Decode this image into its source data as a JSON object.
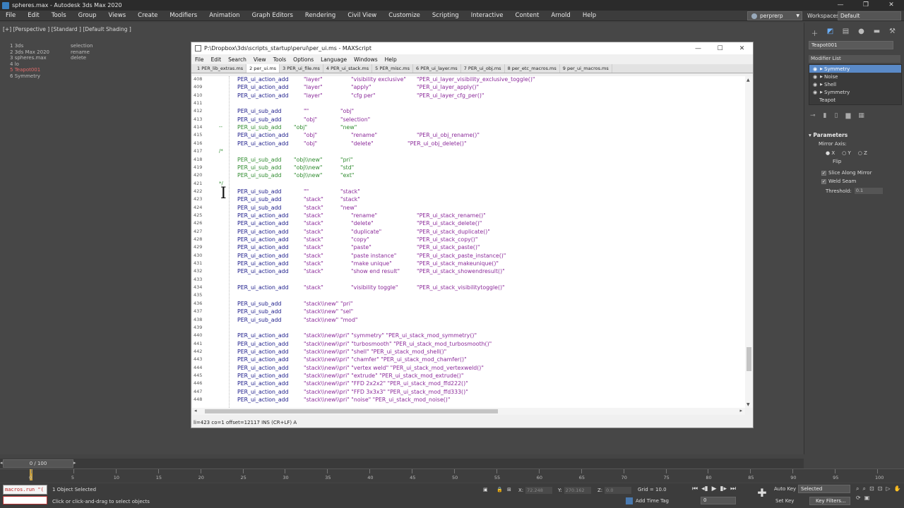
{
  "app": {
    "title": "spheres.max - Autodesk 3ds Max 2020",
    "window_controls": [
      "—",
      "❐",
      "✕"
    ]
  },
  "menu": [
    "File",
    "Edit",
    "Tools",
    "Group",
    "Views",
    "Create",
    "Modifiers",
    "Animation",
    "Graph Editors",
    "Rendering",
    "Civil View",
    "Customize",
    "Scripting",
    "Interactive",
    "Content",
    "Arnold",
    "Help"
  ],
  "user": "perprerp",
  "workspaces": {
    "label": "Workspaces:",
    "value": "Default"
  },
  "viewport": {
    "label": "[+] [Perspective ] [Standard ] [Default Shading ]",
    "scene_list": [
      "3ds",
      "3ds Max 2020",
      "spheres.max",
      "lo",
      "Teapot001",
      "Symmetry"
    ],
    "scene_list_numbers": [
      "1",
      "2",
      "3",
      "4",
      "5",
      "6"
    ],
    "selected_index": 4,
    "menu_list": [
      "selection",
      "rename",
      "delete"
    ]
  },
  "editor": {
    "title": "P:\\Dropbox\\3ds\\scripts_startup\\perui\\per_ui.ms - MAXScript",
    "menu": [
      "File",
      "Edit",
      "Search",
      "View",
      "Tools",
      "Options",
      "Language",
      "Windows",
      "Help"
    ],
    "tabs": [
      "1 PER_lib_extras.ms",
      "2 per_ui.ms",
      "3 PER_ui_file.ms",
      "4 PER_ui_stack.ms",
      "5 PER_misc.ms",
      "6 PER_ui_layer.ms",
      "7 PER_ui_obj.ms",
      "8 per_etc_macros.ms",
      "9 per_ui_macros.ms"
    ],
    "active_tab": 1,
    "status": "li=423 co=1 offset=12117 INS (CR+LF) A",
    "lines": [
      {
        "n": "408",
        "k": "PER_ui_action_add",
        "a": "\"layer\"",
        "b": "\"visibility exclusive\"",
        "c": "\"PER_ui_layer_visibility_exclusive_toggle()\""
      },
      {
        "n": "409",
        "k": "PER_ui_action_add",
        "a": "\"layer\"",
        "b": "\"apply\"",
        "c": "\"PER_ui_layer_apply()\""
      },
      {
        "n": "410",
        "k": "PER_ui_action_add",
        "a": "\"layer\"",
        "b": "\"cfg per\"",
        "c": "\"PER_ui_layer_cfg_per()\""
      },
      {
        "n": "411"
      },
      {
        "n": "412",
        "k": "PER_ui_sub_add",
        "a": "\"\"",
        "b": "\"obj\""
      },
      {
        "n": "413",
        "k": "PER_ui_sub_add",
        "a": "\"obj\"",
        "b": "\"selection\""
      },
      {
        "n": "414",
        "k": "PER_ui_sub_add",
        "a": "\"obj\"",
        "b": "\"new\"",
        "comment": true,
        "mark": "--"
      },
      {
        "n": "415",
        "k": "PER_ui_action_add",
        "a": "\"obj\"",
        "b": "\"rename\"",
        "c": "\"PER_ui_obj_rename()\""
      },
      {
        "n": "416",
        "k": "PER_ui_action_add",
        "a": "\"obj\"",
        "b": "\"delete\"",
        "c": "\"PER_ui_obj_delete()\""
      },
      {
        "n": "417",
        "mark": "/*",
        "comment": true
      },
      {
        "n": "418",
        "k": "PER_ui_sub_add",
        "a": "\"obj\\\\new\"",
        "b": "\"pri\"",
        "comment": true
      },
      {
        "n": "419",
        "k": "PER_ui_sub_add",
        "a": "\"obj\\\\new\"",
        "b": "\"std\"",
        "comment": true
      },
      {
        "n": "420",
        "k": "PER_ui_sub_add",
        "a": "\"obj\\\\new\"",
        "b": "\"ext\"",
        "comment": true
      },
      {
        "n": "421",
        "mark": "*/",
        "comment": true
      },
      {
        "n": "422",
        "k": "PER_ui_sub_add",
        "a": "\"\"",
        "b": "\"stack\""
      },
      {
        "n": "423",
        "k": "PER_ui_sub_add",
        "a": "\"stack\"",
        "b": "\"stack\""
      },
      {
        "n": "424",
        "k": "PER_ui_sub_add",
        "a": "\"stack\"",
        "b": "\"new\""
      },
      {
        "n": "425",
        "k": "PER_ui_action_add",
        "a": "\"stack\"",
        "b": "\"rename\"",
        "c": "\"PER_ui_stack_rename()\""
      },
      {
        "n": "426",
        "k": "PER_ui_action_add",
        "a": "\"stack\"",
        "b": "\"delete\"",
        "c": "\"PER_ui_stack_delete()\""
      },
      {
        "n": "427",
        "k": "PER_ui_action_add",
        "a": "\"stack\"",
        "b": "\"duplicate\"",
        "c": "\"PER_ui_stack_duplicate()\""
      },
      {
        "n": "428",
        "k": "PER_ui_action_add",
        "a": "\"stack\"",
        "b": "\"copy\"",
        "c": "\"PER_ui_stack_copy()\""
      },
      {
        "n": "429",
        "k": "PER_ui_action_add",
        "a": "\"stack\"",
        "b": "\"paste\"",
        "c": "\"PER_ui_stack_paste()\""
      },
      {
        "n": "430",
        "k": "PER_ui_action_add",
        "a": "\"stack\"",
        "b": "\"paste instance\"",
        "c": "\"PER_ui_stack_paste_instance()\""
      },
      {
        "n": "431",
        "k": "PER_ui_action_add",
        "a": "\"stack\"",
        "b": "\"make unique\"",
        "c": "\"PER_ui_stack_makeunique()\""
      },
      {
        "n": "432",
        "k": "PER_ui_action_add",
        "a": "\"stack\"",
        "b": "\"show end result\"",
        "c": "\"PER_ui_stack_showendresult()\""
      },
      {
        "n": "433"
      },
      {
        "n": "434",
        "k": "PER_ui_action_add",
        "a": "\"stack\"",
        "b": "\"visibility toggle\"",
        "c": "\"PER_ui_stack_visibilitytoggle()\""
      },
      {
        "n": "435"
      },
      {
        "n": "436",
        "k": "PER_ui_sub_add",
        "a": "\"stack\\\\new\"",
        "b": "\"pri\""
      },
      {
        "n": "437",
        "k": "PER_ui_sub_add",
        "a": "\"stack\\\\new\"",
        "b": "\"sel\""
      },
      {
        "n": "438",
        "k": "PER_ui_sub_add",
        "a": "\"stack\\\\new\"",
        "b": "\"mod\""
      },
      {
        "n": "439"
      },
      {
        "n": "440",
        "k": "PER_ui_action_add",
        "a": "\"stack\\\\new\\\\pri\" \"symmetry\" \"PER_ui_stack_mod_symmetry()\""
      },
      {
        "n": "441",
        "k": "PER_ui_action_add",
        "a": "\"stack\\\\new\\\\pri\" \"turbosmooth\" \"PER_ui_stack_mod_turbosmooth()\""
      },
      {
        "n": "442",
        "k": "PER_ui_action_add",
        "a": "\"stack\\\\new\\\\pri\" \"shell\" \"PER_ui_stack_mod_shell()\""
      },
      {
        "n": "443",
        "k": "PER_ui_action_add",
        "a": "\"stack\\\\new\\\\pri\" \"chamfer\" \"PER_ui_stack_mod_chamfer()\""
      },
      {
        "n": "444",
        "k": "PER_ui_action_add",
        "a": "\"stack\\\\new\\\\pri\" \"vertex weld\" \"PER_ui_stack_mod_vertexweld()\""
      },
      {
        "n": "445",
        "k": "PER_ui_action_add",
        "a": "\"stack\\\\new\\\\pri\" \"extrude\" \"PER_ui_stack_mod_extrude()\""
      },
      {
        "n": "446",
        "k": "PER_ui_action_add",
        "a": "\"stack\\\\new\\\\pri\" \"FFD 2x2x2\" \"PER_ui_stack_mod_ffd222()\""
      },
      {
        "n": "447",
        "k": "PER_ui_action_add",
        "a": "\"stack\\\\new\\\\pri\" \"FFD 3x3x3\" \"PER_ui_stack_mod_ffd333()\""
      },
      {
        "n": "448",
        "k": "PER_ui_action_add",
        "a": "\"stack\\\\new\\\\pri\" \"noise\" \"PER_ui_stack_mod_noise()\""
      }
    ]
  },
  "command_panel": {
    "object_name": "Teapot001",
    "modifier_list_label": "Modifier List",
    "stack": [
      "Symmetry",
      "Noise",
      "Shell",
      "Symmetry",
      "Teapot"
    ],
    "selected_stack_index": 0,
    "rollout_title": "Parameters",
    "mirror_axis_label": "Mirror Axis:",
    "axes": [
      "X",
      "Y",
      "Z"
    ],
    "flip_label": "Flip",
    "slice_label": "Slice Along Mirror",
    "weld_label": "Weld Seam",
    "threshold_label": "Threshold:",
    "threshold_value": "0.1"
  },
  "timeline": {
    "frame_display": "0 / 100",
    "ticks": [
      "0",
      "5",
      "10",
      "15",
      "20",
      "25",
      "30",
      "35",
      "40",
      "45",
      "50",
      "55",
      "60",
      "65",
      "70",
      "75",
      "80",
      "85",
      "90",
      "95",
      "100"
    ]
  },
  "status": {
    "macro": "macros.run \"(",
    "selection": "1 Object Selected",
    "hint": "Click or click-and-drag to select objects",
    "x_label": "X:",
    "x_value": "72.248",
    "y_label": "Y:",
    "y_value": "270.162",
    "z_label": "Z:",
    "z_value": "0.0",
    "grid": "Grid = 10.0",
    "add_time_tag": "Add Time Tag",
    "auto_key": "Auto Key",
    "set_key": "Set Key",
    "selected_dropdown": "Selected",
    "key_filters": "Key Filters...",
    "frame": "0"
  }
}
